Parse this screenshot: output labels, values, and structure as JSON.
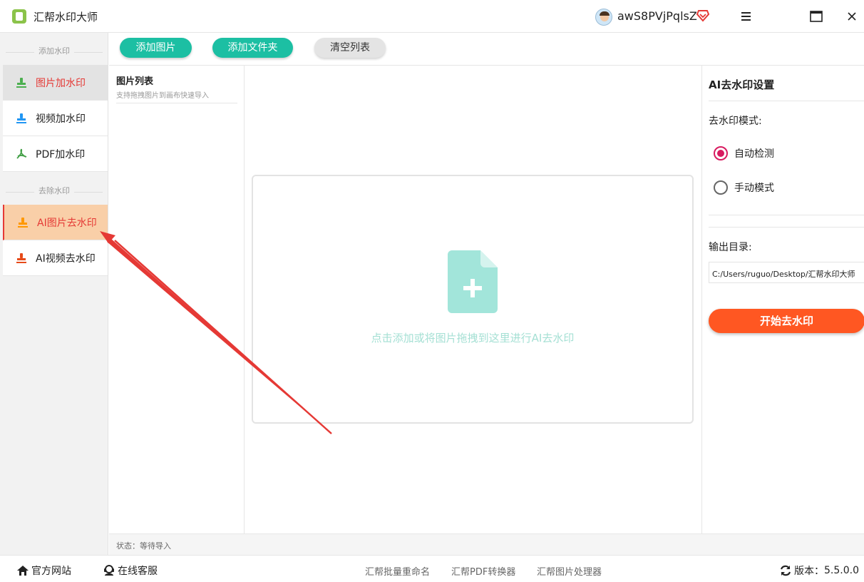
{
  "window": {
    "title": "汇帮水印大师",
    "username": "awS8PVjPqlsZ",
    "icons": [
      "app-logo-icon",
      "avatar-icon",
      "vip-icon",
      "menu-icon",
      "maximize-icon",
      "close-icon"
    ]
  },
  "sidebar": {
    "section_add": "添加水印",
    "section_remove": "去除水印",
    "items": [
      {
        "label": "图片加水印",
        "icon": "image-stamp-icon",
        "color": "#4caf50"
      },
      {
        "label": "视频加水印",
        "icon": "video-stamp-icon",
        "color": "#2196f3"
      },
      {
        "label": "PDF加水印",
        "icon": "pdf-icon",
        "color": "#43a047"
      },
      {
        "label": "AI图片去水印",
        "icon": "ai-image-stamp-icon",
        "color": "#ff9800"
      },
      {
        "label": "AI视频去水印",
        "icon": "ai-video-stamp-icon",
        "color": "#e64a19"
      }
    ]
  },
  "toolbar": {
    "add_image": "添加图片",
    "add_folder": "添加文件夹",
    "clear_list": "清空列表"
  },
  "image_list": {
    "title": "图片列表",
    "subtitle": "支持拖拽图片到画布快速导入"
  },
  "canvas": {
    "drop_text": "点击添加或将图片拖拽到这里进行AI去水印",
    "icon": "add-file-icon"
  },
  "settings": {
    "title": "AI去水印设置",
    "mode_label": "去水印模式:",
    "modes": [
      {
        "label": "自动检测",
        "selected": true
      },
      {
        "label": "手动模式",
        "selected": false
      }
    ],
    "output_label": "输出目录:",
    "output_path": "C:/Users/ruguo/Desktop/汇帮水印大师",
    "start_button": "开始去水印"
  },
  "status": {
    "text": "状态：等待导入"
  },
  "footer": {
    "website": "官方网站",
    "support": "在线客服",
    "link1": "汇帮批量重命名",
    "link2": "汇帮PDF转换器",
    "link3": "汇帮图片处理器",
    "version_label": "版本：",
    "version_value": "5.5.0.0"
  },
  "colors": {
    "accent_teal": "#1cbfa3",
    "accent_orange": "#ff5722",
    "selected_text": "#e53935",
    "arrow": "#e53935"
  }
}
